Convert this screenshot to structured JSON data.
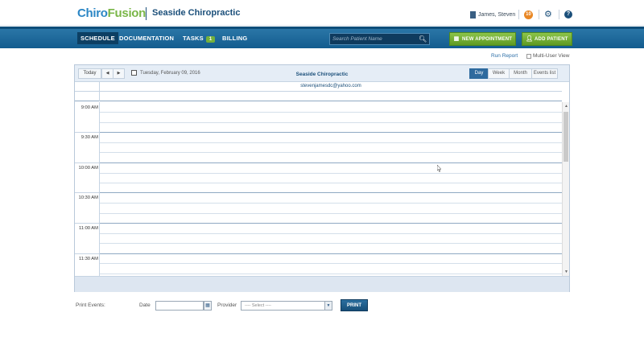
{
  "header": {
    "logo_part1": "Chiro",
    "logo_part2": "Fusion",
    "practice_name": "Seaside Chiropractic",
    "user_name": "James, Steven",
    "notification_count": "10"
  },
  "nav": {
    "schedule": "SCHEDULE",
    "documentation": "DOCUMENTATION",
    "tasks": "TASKS",
    "tasks_badge": "1",
    "billing": "BILLING",
    "search_placeholder": "Search Patient Name",
    "new_appointment": "NEW APPOINTMENT",
    "add_patient": "ADD PATIENT"
  },
  "subtoolbar": {
    "run_report": "Run Report",
    "multi_user_view": "Multi-User View"
  },
  "calendar": {
    "today": "Today",
    "prev": "◀",
    "next": "▶",
    "current_date": "Tuesday, February 09, 2016",
    "title": "Seaside Chiropractic",
    "views": [
      "Day",
      "Week",
      "Month",
      "Events list"
    ],
    "active_view": "Day",
    "resource": "stevenjamesdc@yahoo.com",
    "time_slots": [
      "9:00 AM",
      "9:30 AM",
      "10:00 AM",
      "10:30 AM",
      "11:00 AM",
      "11:30 AM"
    ]
  },
  "print_events": {
    "label": "Print Events:",
    "date_label": "Date",
    "date_value": "",
    "provider_label": "Provider",
    "provider_selected": "---- Select ----",
    "print_button": "PRINT"
  },
  "colors": {
    "brand_blue": "#2b86c5",
    "brand_green": "#7ab648",
    "nav_blue": "#135c8f",
    "notification_orange": "#e98724",
    "active_view_blue": "#2e6a9e"
  }
}
